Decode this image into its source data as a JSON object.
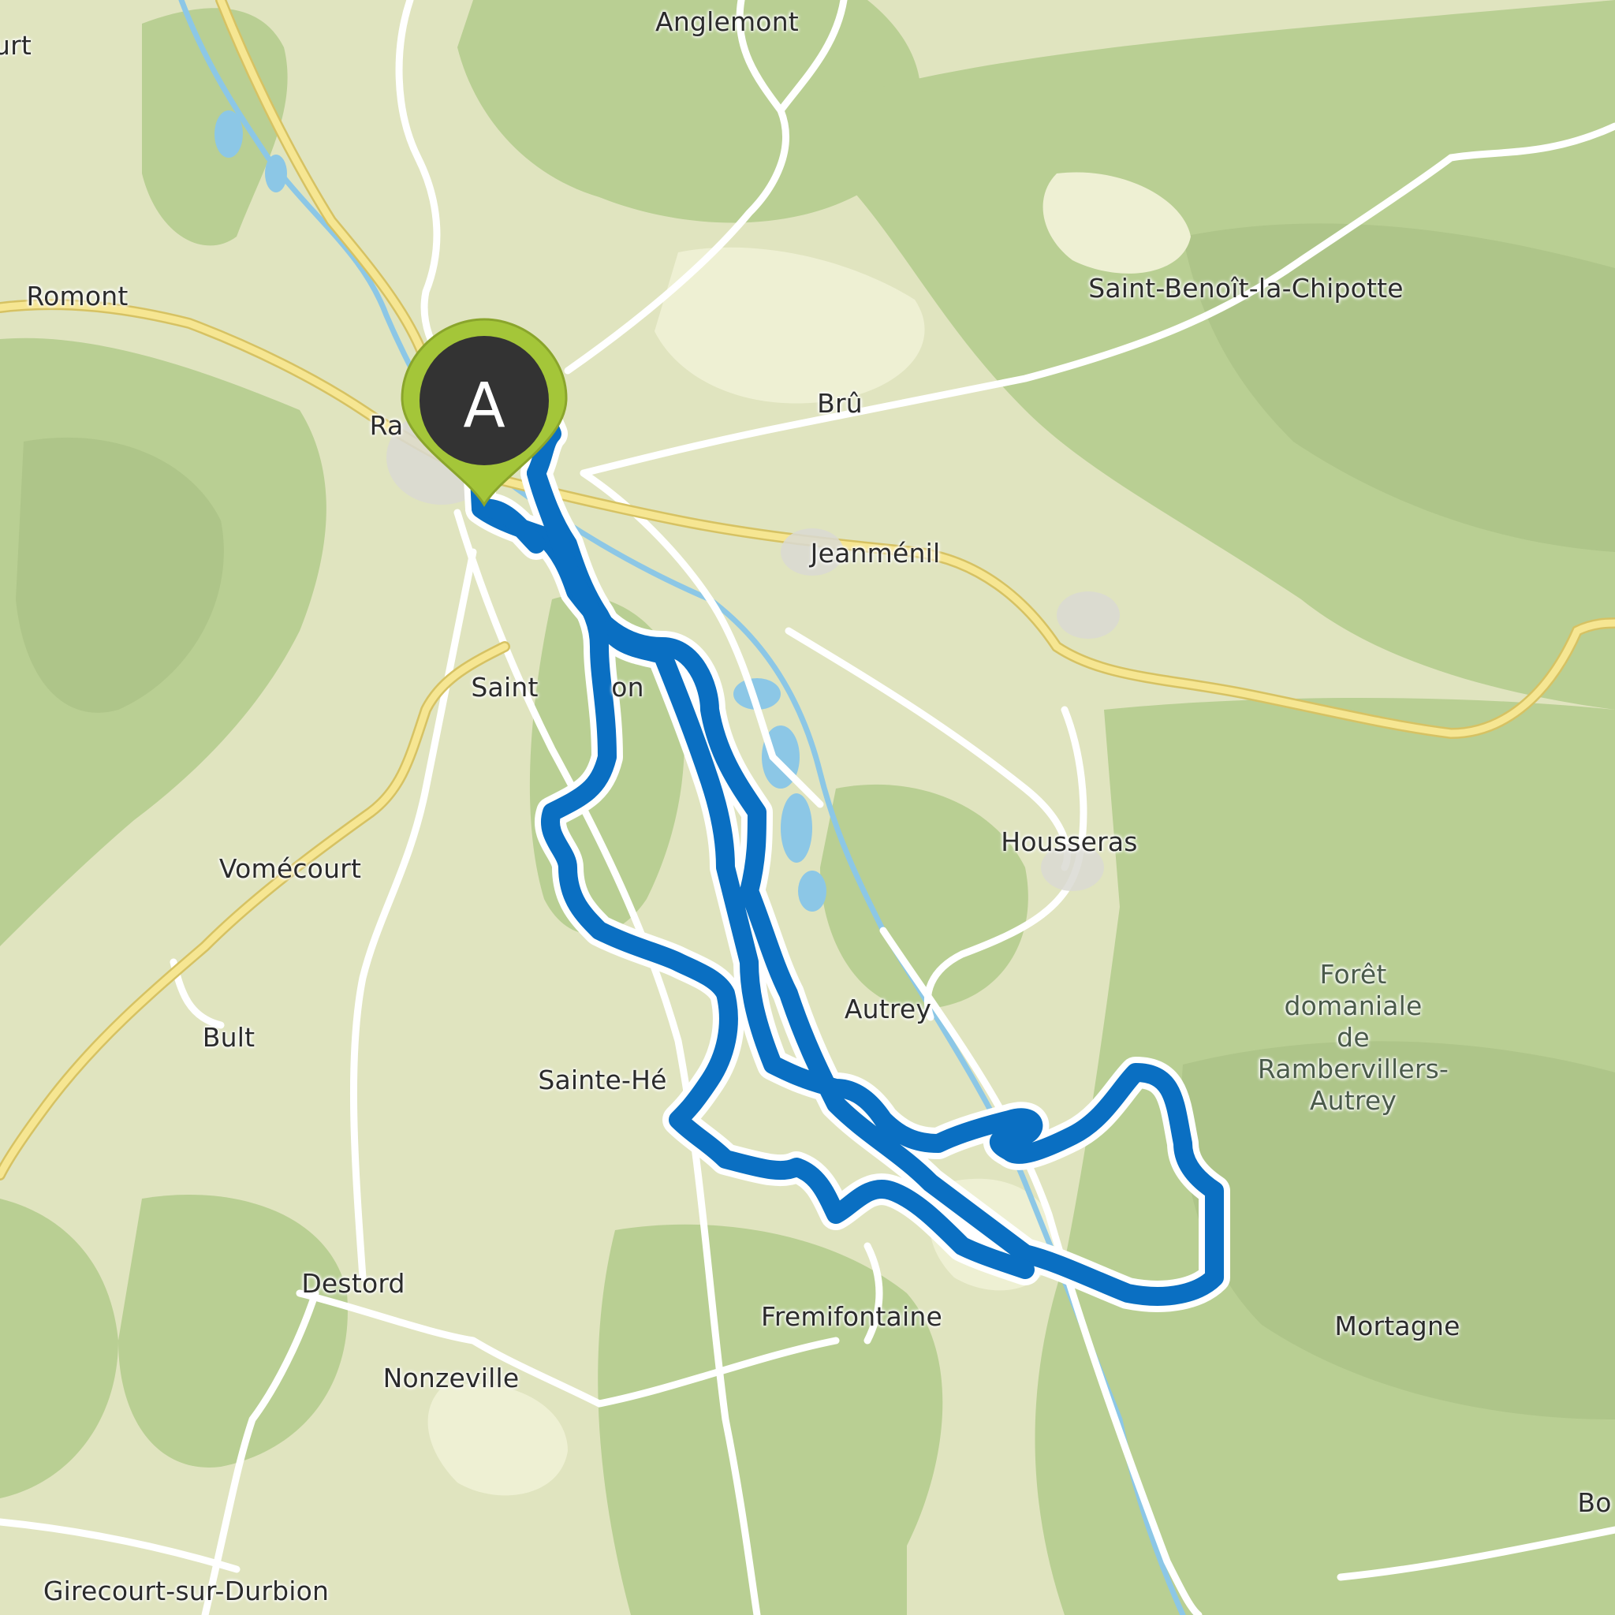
{
  "map": {
    "start_marker": {
      "label": "A",
      "color": "#a4c639"
    },
    "route_color": "#0a6fc2",
    "places": {
      "anglemont": "Anglemont",
      "court_edge": "urt",
      "romont": "Romont",
      "rambervillers_partial": "Ra",
      "saint_benoit": "Saint-Benoît-la-Chipotte",
      "bru": "Brû",
      "jeanmenil": "Jeanménil",
      "saint_gorgon_left": "Saint",
      "saint_gorgon_right": "on",
      "housseras": "Housseras",
      "vomecourt": "Vomécourt",
      "autrey": "Autrey",
      "bult": "Bult",
      "sainte_helene": "Sainte-Hé",
      "foret_line1": "Forêt",
      "foret_line2": "domaniale",
      "foret_line3": "de",
      "foret_line4": "Rambervillers-",
      "foret_line5": "Autrey",
      "destord": "Destord",
      "fremifontaine": "Fremifontaine",
      "mortagne": "Mortagne",
      "nonzeville": "Nonzeville",
      "girecourt": "Girecourt-sur-Durbion",
      "bo_edge": "Bo"
    }
  }
}
